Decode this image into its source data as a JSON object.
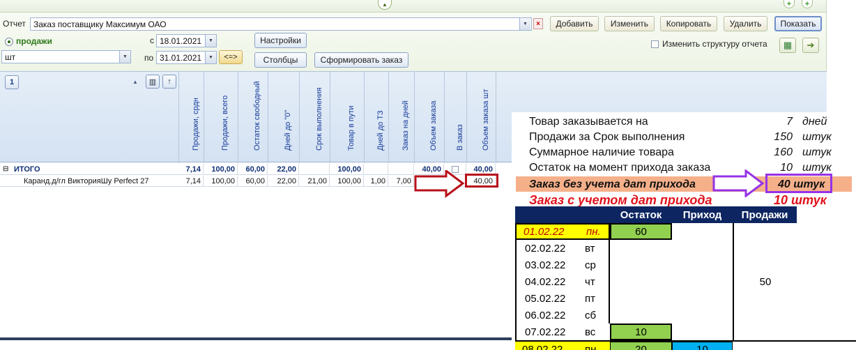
{
  "window": {
    "collapse_glyph": "▲",
    "icons": [
      "add-icon",
      "plus-icon"
    ]
  },
  "toolbar": {
    "report_label": "Отчет",
    "report_value": "Заказ поставщику Максимум ОАО",
    "add_label": "Добавить",
    "edit_label": "Изменить",
    "copy_label": "Копировать",
    "delete_label": "Удалить",
    "show_label": "Показать",
    "sales_radio_label": "продажи",
    "unit_value": "шт",
    "from_label": "с",
    "from_date": "18.01.2021",
    "to_label": "по",
    "to_date": "31.01.2021",
    "period_button": "<=>",
    "settings_label": "Настройки",
    "columns_label": "Столбцы",
    "make_order_label": "Сформировать заказ",
    "change_structure_label": "Изменить структуру отчета"
  },
  "grid": {
    "level_badge": "1",
    "columns": [
      "Продажи, срдн",
      "Продажи, всего",
      "Остаток свободный",
      "Дней до \"0\"",
      "Срок выполнения",
      "Товар в пути",
      "Дней до ТЗ",
      "Заказ на дней",
      "Объем заказа",
      "В заказ",
      "Объем заказа шт"
    ],
    "total_row": {
      "name": "ИТОГО",
      "values": [
        "7,14",
        "100,00",
        "60,00",
        "22,00",
        "",
        "100,00",
        "",
        "",
        "40,00",
        "",
        "40,00"
      ]
    },
    "item_row": {
      "name": "Каранд.д/гл ВикторияШу Perfect 27",
      "values": [
        "7,14",
        "100,00",
        "60,00",
        "22,00",
        "21,00",
        "100,00",
        "1,00",
        "7,00",
        "",
        "",
        "40,00"
      ]
    }
  },
  "overlay": {
    "lines": [
      {
        "text": "Товар заказывается на",
        "value": "7",
        "unit": "дней"
      },
      {
        "text": "Продажи за Срок выполнения",
        "value": "150",
        "unit": "штук"
      },
      {
        "text": "Суммарное наличие товара",
        "value": "160",
        "unit": "штук"
      },
      {
        "text": "Остаток на момент прихода заказа",
        "value": "10",
        "unit": "штук"
      }
    ],
    "highlight": {
      "text": "Заказ без учета дат прихода",
      "value": "40 штук"
    },
    "with_dates": {
      "text": "Заказ с учетом дат прихода",
      "value": "10 штук"
    },
    "table": {
      "headers": [
        "Остаток",
        "Приход",
        "Продажи"
      ],
      "rows": [
        {
          "date": "01.02.22",
          "day": "пн.",
          "stock": "60",
          "income": ""
        },
        {
          "date": "02.02.22",
          "day": "вт",
          "stock": "",
          "income": ""
        },
        {
          "date": "03.02.22",
          "day": "ср",
          "stock": "",
          "income": ""
        },
        {
          "date": "04.02.22",
          "day": "чт",
          "stock": "",
          "income": ""
        },
        {
          "date": "05.02.22",
          "day": "пт",
          "stock": "",
          "income": ""
        },
        {
          "date": "06.02.22",
          "day": "сб",
          "stock": "",
          "income": ""
        },
        {
          "date": "07.02.22",
          "day": "вс",
          "stock": "10",
          "income": ""
        },
        {
          "date": "08.02.22",
          "day": "пн",
          "stock": "20",
          "income": "10"
        }
      ],
      "sales_merged": "50"
    },
    "colors": {
      "yellow": "#ffff00",
      "green": "#92d050",
      "blue": "#00b0f0",
      "header": "#0d2661",
      "salmon": "#f5b08a",
      "purple": "#9632e6",
      "red": "#e0121c"
    }
  }
}
